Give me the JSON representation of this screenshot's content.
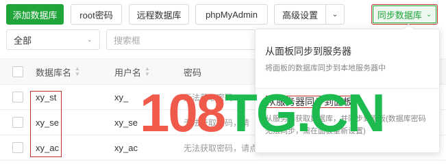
{
  "toolbar": {
    "add_db": "添加数据库",
    "root_pwd": "root密码",
    "remote_db": "远程数据库",
    "phpmyadmin": "phpMyAdmin",
    "advanced": "高级设置",
    "sync_db": "同步数据库"
  },
  "filter": {
    "select_value": "全部",
    "search_placeholder": "搜索框"
  },
  "table": {
    "headers": {
      "db_name": "数据库名",
      "username": "用户名",
      "password": "密码"
    },
    "rows": [
      {
        "name": "xy_st",
        "user": "xy_",
        "pwd": "无法获取密码"
      },
      {
        "name": "xy_se",
        "user": "xy_se",
        "pwd": "无法获取密码，请"
      },
      {
        "name": "xy_ac",
        "user": "xy_ac",
        "pwd": "无法获取密码，请点"
      }
    ]
  },
  "dropdown": {
    "item1_title": "从面板同步到服务器",
    "item1_desc": "将面板的数据库同步到本地服务器中",
    "item2_title": "从服务器同步到面板",
    "item2_desc": "从服务器获取数据库，并同步到面板(数据库密码无法同步，需在面板重新设置)"
  },
  "watermark": {
    "part1": "108",
    "part2": "TG.CN"
  },
  "colors": {
    "green": "#20a53a",
    "highlight": "#c3312b"
  }
}
